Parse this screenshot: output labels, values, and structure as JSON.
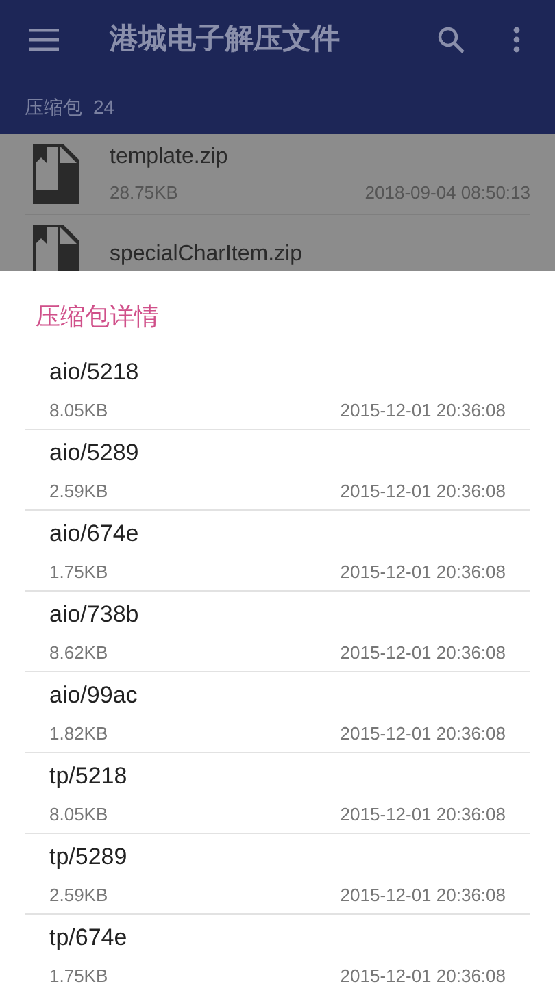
{
  "app_bar": {
    "title": "港城电子解压文件"
  },
  "subheader": {
    "label": "压缩包",
    "count": "24"
  },
  "files": [
    {
      "name": "template.zip",
      "size": "28.75KB",
      "date": "2018-09-04 08:50:13"
    },
    {
      "name": "specialCharItem.zip"
    }
  ],
  "sheet": {
    "title": "压缩包详情",
    "entries": [
      {
        "name": "aio/5218",
        "size": "8.05KB",
        "date": "2015-12-01 20:36:08"
      },
      {
        "name": "aio/5289",
        "size": "2.59KB",
        "date": "2015-12-01 20:36:08"
      },
      {
        "name": "aio/674e",
        "size": "1.75KB",
        "date": "2015-12-01 20:36:08"
      },
      {
        "name": "aio/738b",
        "size": "8.62KB",
        "date": "2015-12-01 20:36:08"
      },
      {
        "name": "aio/99ac",
        "size": "1.82KB",
        "date": "2015-12-01 20:36:08"
      },
      {
        "name": "tp/5218",
        "size": "8.05KB",
        "date": "2015-12-01 20:36:08"
      },
      {
        "name": "tp/5289",
        "size": "2.59KB",
        "date": "2015-12-01 20:36:08"
      },
      {
        "name": "tp/674e",
        "size": "1.75KB",
        "date": "2015-12-01 20:36:08"
      }
    ]
  }
}
